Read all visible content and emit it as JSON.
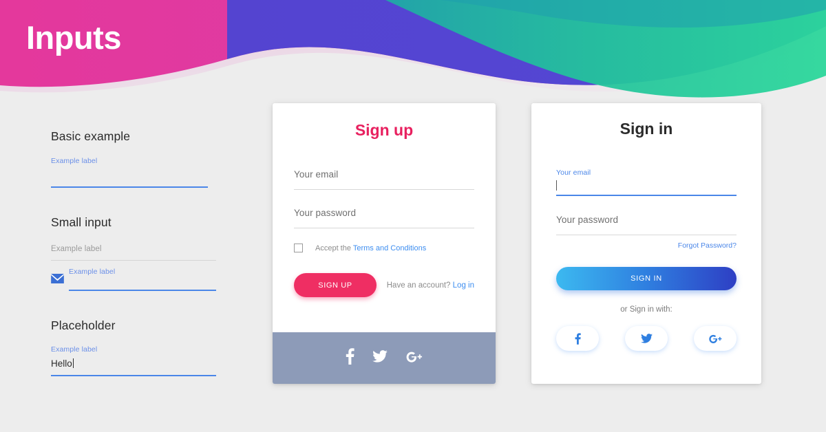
{
  "page": {
    "title": "Inputs",
    "background_color": "#ededed"
  },
  "hero": {
    "wave_colors": {
      "pink": "#e040a0",
      "magenta": "#d93ba0",
      "purple": "#4a45d0",
      "blue_purple": "#5145d8",
      "teal": "#21b898",
      "green": "#2ad396",
      "pink_soft": "#efd0e4"
    }
  },
  "left_column": {
    "basic": {
      "heading": "Basic example",
      "label": "Example label",
      "value": ""
    },
    "small": {
      "heading": "Small input",
      "field1": {
        "label": "Example label",
        "value": ""
      },
      "field2": {
        "label": "Example label",
        "value": "",
        "icon": "envelope-icon"
      }
    },
    "placeholder": {
      "heading": "Placeholder",
      "label": "Example label",
      "value": "Hello"
    }
  },
  "signup_card": {
    "title": "Sign up",
    "title_color": "#e8205f",
    "email_label": "Your email",
    "password_label": "Your password",
    "terms_prefix": "Accept the",
    "terms_link": "Terms and Conditions",
    "submit_label": "SIGN UP",
    "submit_color": "#ef2e63",
    "have_account_text": "Have an account?",
    "login_link": "Log in",
    "footer_color": "#8d9bb8",
    "social": [
      {
        "name": "facebook-icon",
        "label": "Facebook"
      },
      {
        "name": "twitter-icon",
        "label": "Twitter"
      },
      {
        "name": "google-plus-icon",
        "label": "Google Plus"
      }
    ]
  },
  "signin_card": {
    "title": "Sign in",
    "title_color": "#2b2b2b",
    "email_label": "Your email",
    "email_value": "",
    "password_label": "Your password",
    "forgot_link": "Forgot Password?",
    "submit_label": "SIGN IN",
    "or_text": "or Sign in with:",
    "social": [
      {
        "name": "facebook-icon",
        "label": "Facebook"
      },
      {
        "name": "twitter-icon",
        "label": "Twitter"
      },
      {
        "name": "google-plus-icon",
        "label": "Google Plus"
      }
    ]
  }
}
